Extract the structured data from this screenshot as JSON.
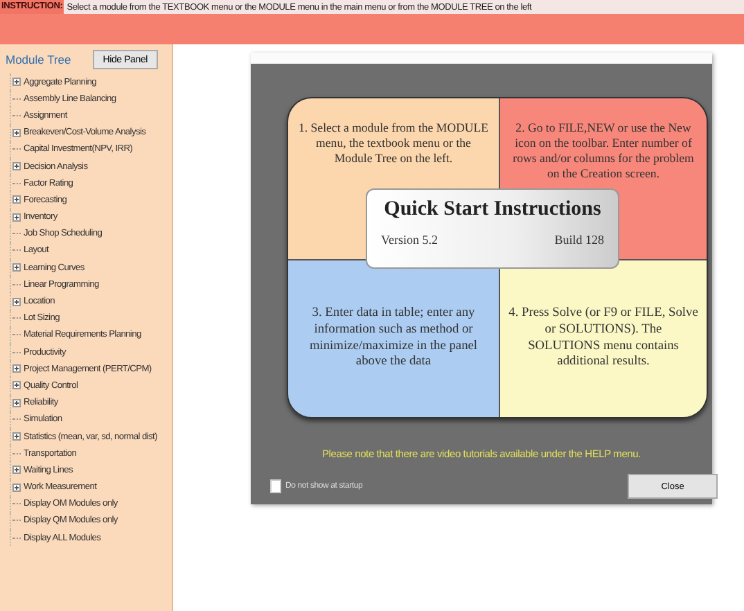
{
  "instruction": {
    "label": "INSTRUCTION:",
    "text": "Select a module from the TEXTBOOK menu or the MODULE menu in the main menu or from the MODULE TREE on the left"
  },
  "sidebar": {
    "title": "Module Tree",
    "button": "Hide Panel",
    "items": [
      {
        "label": "Aggregate Planning",
        "kind": "group"
      },
      {
        "label": "Assembly Line Balancing",
        "kind": "leaf"
      },
      {
        "label": "Assignment",
        "kind": "leaf"
      },
      {
        "label": "Breakeven/Cost-Volume Analysis",
        "kind": "group"
      },
      {
        "label": "Capital Investment(NPV, IRR)",
        "kind": "leaf"
      },
      {
        "label": "Decision Analysis",
        "kind": "group"
      },
      {
        "label": "Factor Rating",
        "kind": "leaf"
      },
      {
        "label": "Forecasting",
        "kind": "group"
      },
      {
        "label": "Inventory",
        "kind": "group"
      },
      {
        "label": "Job Shop Scheduling",
        "kind": "leaf"
      },
      {
        "label": "Layout",
        "kind": "leaf"
      },
      {
        "label": "Learning Curves",
        "kind": "group"
      },
      {
        "label": "Linear Programming",
        "kind": "leaf"
      },
      {
        "label": "Location",
        "kind": "group"
      },
      {
        "label": "Lot Sizing",
        "kind": "leaf"
      },
      {
        "label": "Material Requirements Planning",
        "kind": "leaf"
      },
      {
        "label": "Productivity",
        "kind": "leaf"
      },
      {
        "label": "Project Management (PERT/CPM)",
        "kind": "group"
      },
      {
        "label": "Quality Control",
        "kind": "group"
      },
      {
        "label": "Reliability",
        "kind": "group"
      },
      {
        "label": "Simulation",
        "kind": "leaf"
      },
      {
        "label": "Statistics (mean, var, sd, normal dist)",
        "kind": "group"
      },
      {
        "label": "Transportation",
        "kind": "leaf"
      },
      {
        "label": "Waiting Lines",
        "kind": "group"
      },
      {
        "label": "Work Measurement",
        "kind": "group"
      },
      {
        "label": "Display OM Modules only",
        "kind": "leaf"
      },
      {
        "label": "Display QM Modules only",
        "kind": "leaf"
      },
      {
        "label": "Display ALL Modules",
        "kind": "leaf"
      }
    ]
  },
  "dialog": {
    "steps": [
      {
        "text": "1. Select a module from the MODULE menu, the textbook menu or the Module Tree on the left.",
        "color": "#fcd6ac"
      },
      {
        "text": "2. Go to FILE,NEW or use the New icon on the toolbar. Enter number of rows and/or columns for the problem on the Creation screen.",
        "color": "#f8877b"
      },
      {
        "text": "3. Enter data in table; enter any information such as method or minimize/maximize in the panel above the data",
        "color": "#acccf2"
      },
      {
        "text": "4. Press Solve (or F9 or FILE, Solve or SOLUTIONS). The SOLUTIONS menu contains additional results.",
        "color": "#fbf8c6"
      }
    ],
    "title": "Quick Start Instructions",
    "version": "Version 5.2",
    "build": "Build 128",
    "note": "Please note that there are video tutorials available under the HELP menu.",
    "checkbox": {
      "label": "Do not show at startup",
      "checked": false
    },
    "close": "Close"
  }
}
